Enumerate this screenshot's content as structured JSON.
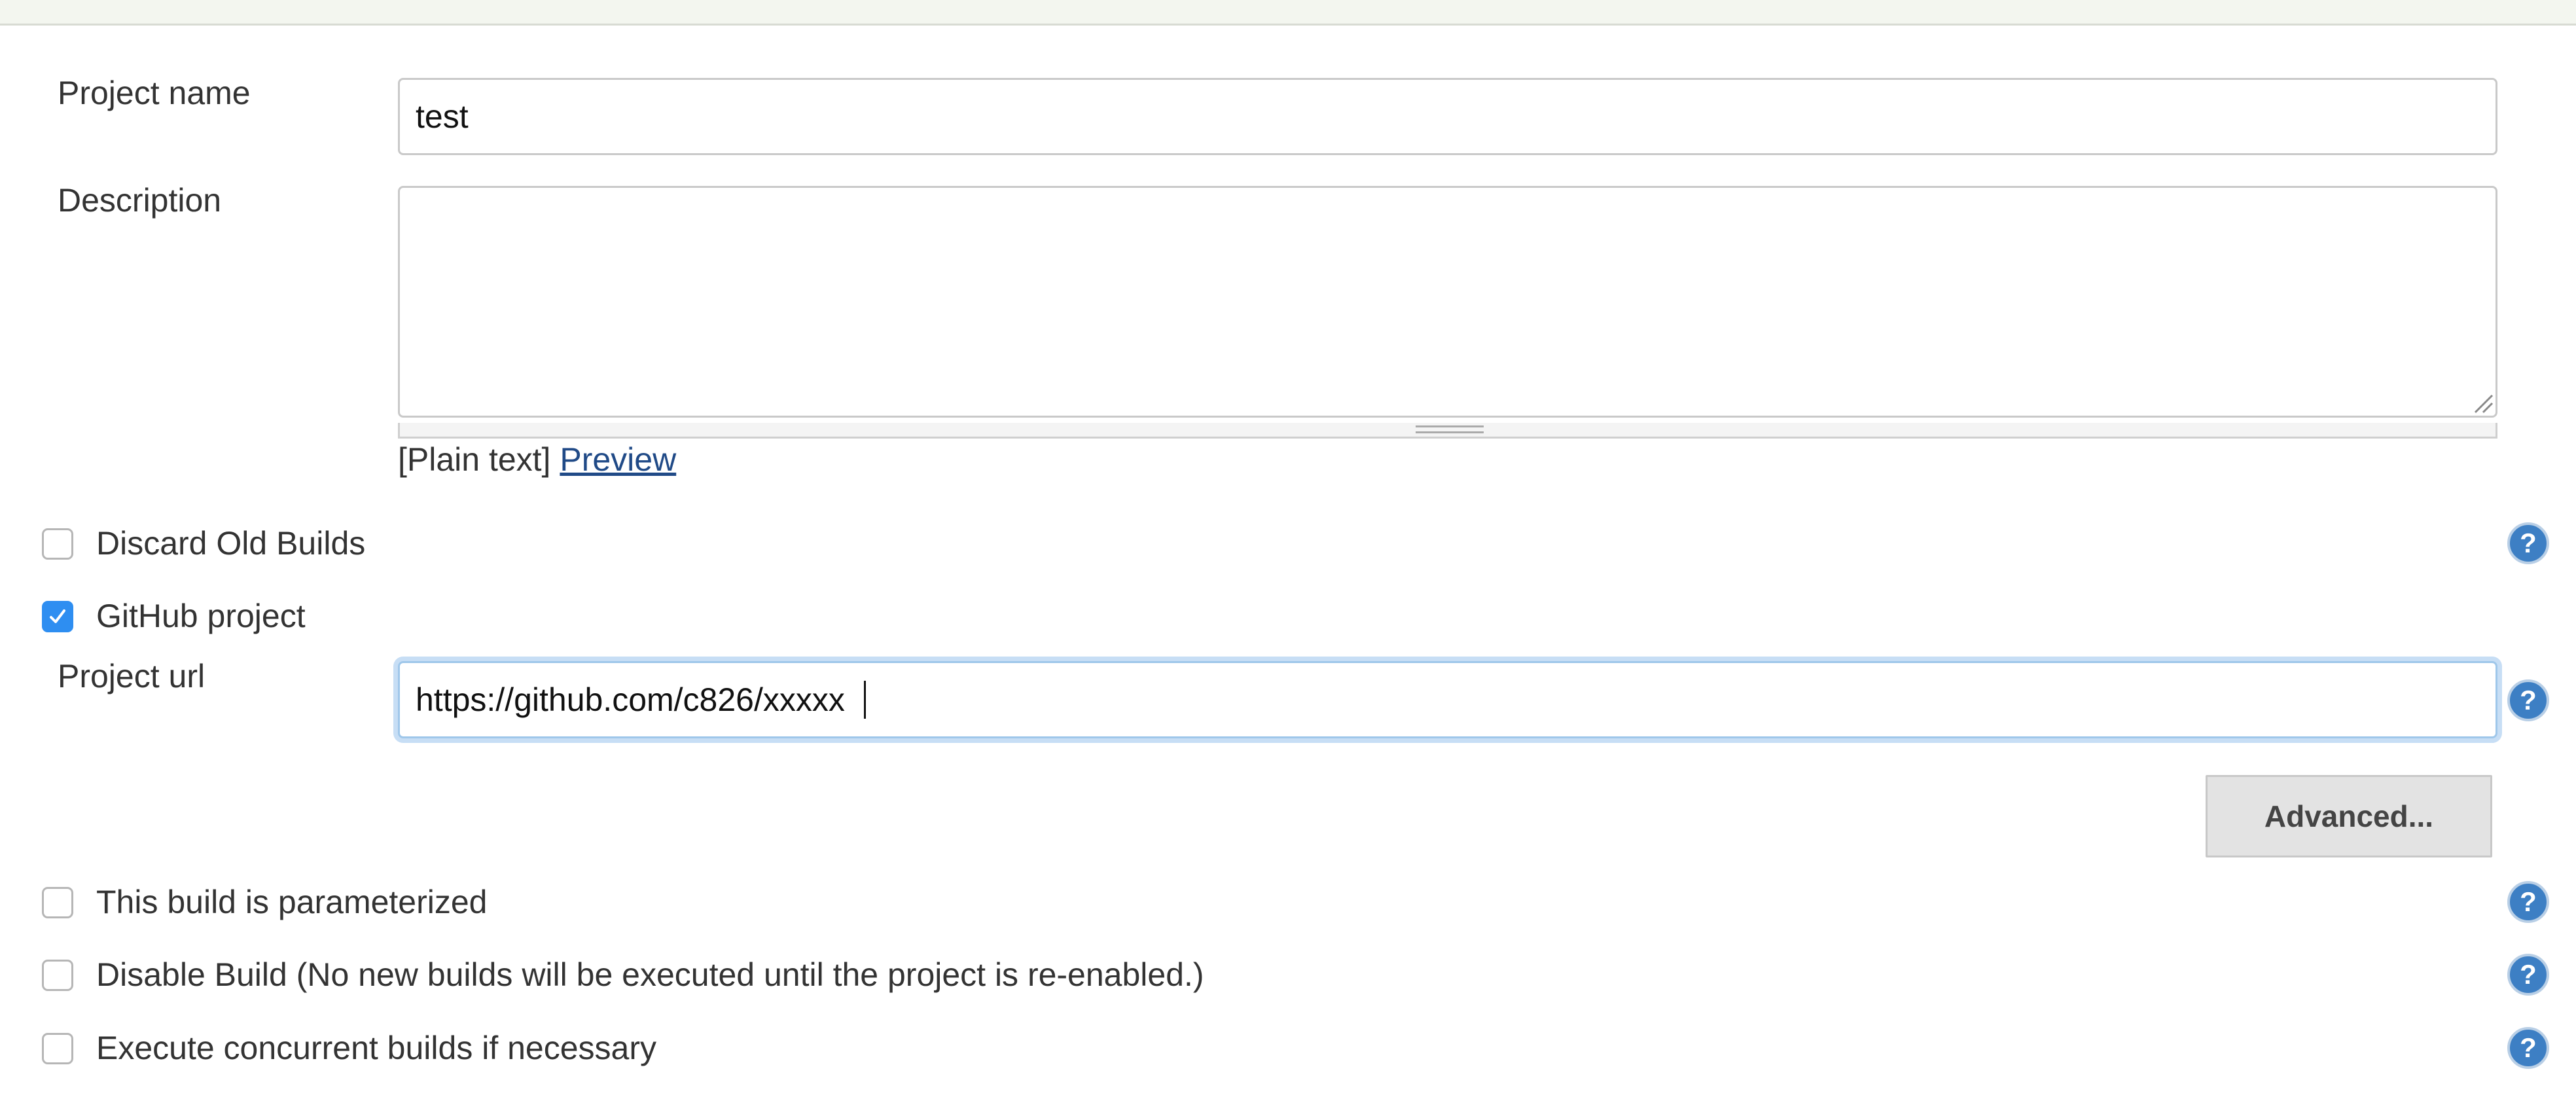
{
  "form": {
    "project_name": {
      "label": "Project name",
      "value": "test"
    },
    "description": {
      "label": "Description",
      "value": "",
      "format_prefix": "[Plain text]",
      "preview_link": "Preview"
    },
    "options": {
      "discard_old_builds": {
        "label": "Discard Old Builds",
        "checked": false
      },
      "github_project": {
        "label": "GitHub project",
        "checked": true
      },
      "parameterized": {
        "label": "This build is parameterized",
        "checked": false
      },
      "disable_build": {
        "label": "Disable Build (No new builds will be executed until the project is re-enabled.)",
        "checked": false
      },
      "concurrent_builds": {
        "label": "Execute concurrent builds if necessary",
        "checked": false
      }
    },
    "project_url": {
      "label": "Project url",
      "value": "https://github.com/c826/xxxxx"
    },
    "advanced_button": "Advanced..."
  },
  "icons": {
    "help": "help-icon",
    "checkmark": "checkmark-icon",
    "resize": "resize-grip-icon"
  },
  "colors": {
    "checkbox_checked": "#2e8ef1",
    "link": "#204a87",
    "focus_ring": "#c7def5",
    "help_icon": "#3d7fc4"
  }
}
